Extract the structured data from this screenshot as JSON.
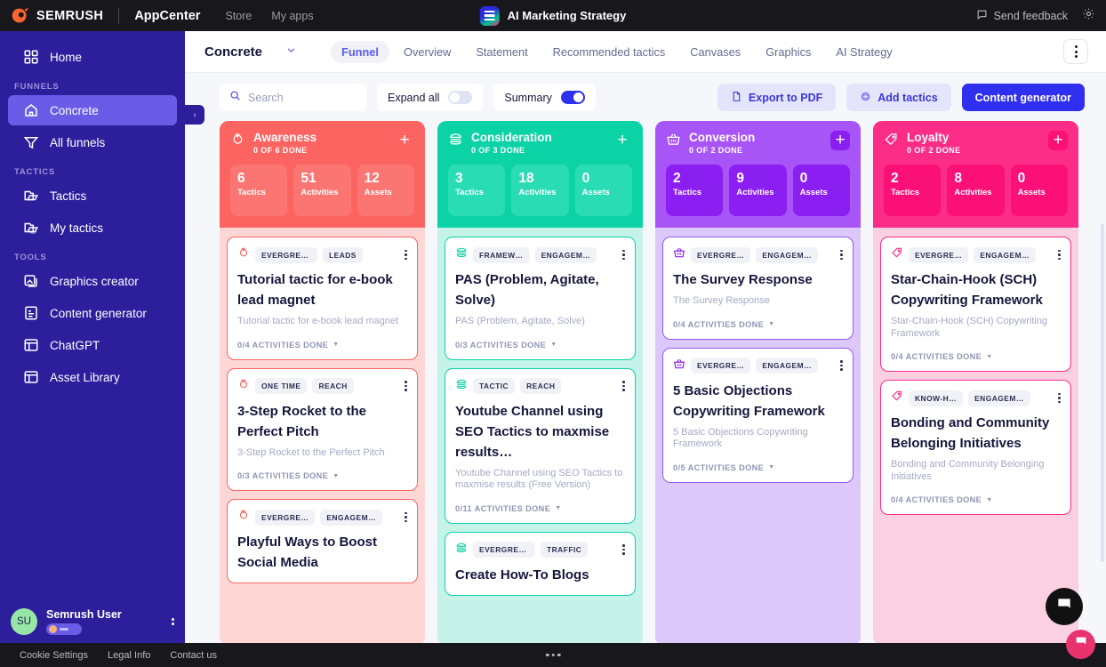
{
  "topbar": {
    "brand": "SEMRUSH",
    "brand_sub": "AppCenter",
    "nav": [
      {
        "label": "Store"
      },
      {
        "label": "My apps"
      }
    ],
    "app_title": "AI Marketing Strategy",
    "feedback_label": "Send feedback",
    "feedback_icon": "chat-icon",
    "settings_icon": "gear-icon"
  },
  "sidebar": {
    "home": {
      "label": "Home",
      "icon": "grid-icon"
    },
    "groups": [
      {
        "label": "FUNNELS",
        "items": [
          {
            "label": "Concrete",
            "icon": "house-icon",
            "active": true
          },
          {
            "label": "All funnels",
            "icon": "funnel-icon",
            "active": false
          }
        ]
      },
      {
        "label": "TACTICS",
        "items": [
          {
            "label": "Tactics",
            "icon": "folder-icon",
            "active": false
          },
          {
            "label": "My tactics",
            "icon": "folder-my-icon",
            "active": false
          }
        ]
      },
      {
        "label": "TOOLS",
        "items": [
          {
            "label": "Graphics creator",
            "icon": "image-icon",
            "active": false
          },
          {
            "label": "Content generator",
            "icon": "document-icon",
            "active": false
          },
          {
            "label": "ChatGPT",
            "icon": "layout-icon",
            "active": false
          },
          {
            "label": "Asset Library",
            "icon": "layout-icon",
            "active": false
          }
        ]
      }
    ],
    "user": {
      "initials": "SU",
      "name": "Semrush User"
    },
    "collapse_icon": "chevron-right-icon"
  },
  "page": {
    "funnel_name": "Concrete",
    "tabs": [
      {
        "label": "Funnel",
        "active": true
      },
      {
        "label": "Overview",
        "active": false
      },
      {
        "label": "Statement",
        "active": false
      },
      {
        "label": "Recommended tactics",
        "active": false
      },
      {
        "label": "Canvases",
        "active": false
      },
      {
        "label": "Graphics",
        "active": false
      },
      {
        "label": "AI Strategy",
        "active": false
      }
    ]
  },
  "toolbar": {
    "search_placeholder": "Search",
    "search_value": "",
    "search_icon": "search-icon",
    "expand_all_label": "Expand all",
    "expand_all_on": false,
    "summary_label": "Summary",
    "summary_on": true,
    "export_label": "Export to PDF",
    "export_icon": "export-icon",
    "add_tactics_label": "Add tactics",
    "add_tactics_icon": "plus-circle-icon",
    "content_generator_label": "Content generator"
  },
  "columns": [
    {
      "title": "Awareness",
      "subtitle": "0 OF 6 DONE",
      "icon": "flame-icon",
      "color": "#fc6461",
      "head_bg": "#fc6461",
      "body_bg": "#fdd7d5",
      "stat_bg": "#fb7673",
      "plus_bg": "rgba(255,255,255,0)",
      "border": "#fc6461",
      "stats": [
        {
          "n": "6",
          "l": "Tactics"
        },
        {
          "n": "51",
          "l": "Activities"
        },
        {
          "n": "12",
          "l": "Assets"
        }
      ],
      "cards": [
        {
          "tags": [
            "EVERGREEN",
            "LEADS"
          ],
          "title": "Tutorial tactic for e-book lead magnet",
          "desc": "Tutorial tactic for e-book lead magnet",
          "footer": "0/4 ACTIVITIES DONE"
        },
        {
          "tags": [
            "ONE TIME",
            "REACH"
          ],
          "title": "3-Step Rocket to the Perfect Pitch",
          "desc": "3-Step Rocket to the Perfect Pitch",
          "footer": "0/3 ACTIVITIES DONE"
        },
        {
          "tags": [
            "EVERGRE…",
            "ENGAGEME…"
          ],
          "title": "Playful Ways to Boost Social Media",
          "desc": "",
          "footer": ""
        }
      ]
    },
    {
      "title": "Consideration",
      "subtitle": "0 OF 3 DONE",
      "icon": "burger-icon",
      "color": "#0cd3a6",
      "head_bg": "#0cd3a6",
      "body_bg": "#c6f3e9",
      "stat_bg": "#2adcb4",
      "plus_bg": "rgba(255,255,255,0)",
      "border": "#0cd3a6",
      "stats": [
        {
          "n": "3",
          "l": "Tactics"
        },
        {
          "n": "18",
          "l": "Activities"
        },
        {
          "n": "0",
          "l": "Assets"
        }
      ],
      "cards": [
        {
          "tags": [
            "FRAMEW…",
            "ENGAGEM…"
          ],
          "title": "PAS (Problem, Agitate, Solve)",
          "desc": "PAS (Problem, Agitate, Solve)",
          "footer": "0/3 ACTIVITIES DONE"
        },
        {
          "tags": [
            "TACTIC",
            "REACH"
          ],
          "title": "Youtube Channel using SEO Tactics to maxmise results…",
          "desc": "Youtube Channel using SEO Tactics to maxmise results (Free Version)",
          "footer": "0/11 ACTIVITIES DONE"
        },
        {
          "tags": [
            "EVERGREEN",
            "TRAFFIC"
          ],
          "title": "Create How-To Blogs",
          "desc": "",
          "footer": ""
        }
      ]
    },
    {
      "title": "Conversion",
      "subtitle": "0 OF 2 DONE",
      "icon": "basket-icon",
      "color": "#a855f7",
      "head_bg": "#a855f7",
      "body_bg": "#ddc8fb",
      "stat_bg": "#8b1ff2",
      "plus_bg": "#8b1ff2",
      "border": "#8b5cf6",
      "stats": [
        {
          "n": "2",
          "l": "Tactics"
        },
        {
          "n": "9",
          "l": "Activities"
        },
        {
          "n": "0",
          "l": "Assets"
        }
      ],
      "cards": [
        {
          "tags": [
            "EVERGRE…",
            "ENGAGEME…"
          ],
          "title": "The Survey Response",
          "desc": "The Survey Response",
          "footer": "0/4 ACTIVITIES DONE"
        },
        {
          "tags": [
            "EVERGRE…",
            "ENGAGEME…"
          ],
          "title": "5 Basic Objections Copywriting Framework",
          "desc": "5 Basic Objections Copywriting Framework",
          "footer": "0/5 ACTIVITIES DONE"
        }
      ]
    },
    {
      "title": "Loyalty",
      "subtitle": "0 OF 2 DONE",
      "icon": "tag-icon",
      "color": "#fb2d87",
      "head_bg": "#fb2d87",
      "body_bg": "#fbd0e2",
      "stat_bg": "#fa1077",
      "plus_bg": "#fa1077",
      "border": "#fb2d87",
      "stats": [
        {
          "n": "2",
          "l": "Tactics"
        },
        {
          "n": "8",
          "l": "Activities"
        },
        {
          "n": "0",
          "l": "Assets"
        }
      ],
      "cards": [
        {
          "tags": [
            "EVERGRE…",
            "ENGAGEME…"
          ],
          "title": "Star-Chain-Hook (SCH) Copywriting Framework",
          "desc": "Star-Chain-Hook (SCH) Copywriting Framework",
          "footer": "0/4 ACTIVITIES DONE"
        },
        {
          "tags": [
            "KNOW-H…",
            "ENGAGEM…"
          ],
          "title": "Bonding and Community Belonging Initiatives",
          "desc": "Bonding and Community Belonging Initiatives",
          "footer": "0/4 ACTIVITIES DONE"
        }
      ]
    }
  ],
  "footer": {
    "links": [
      {
        "label": "Cookie Settings"
      },
      {
        "label": "Legal Info"
      },
      {
        "label": "Contact us"
      }
    ]
  }
}
